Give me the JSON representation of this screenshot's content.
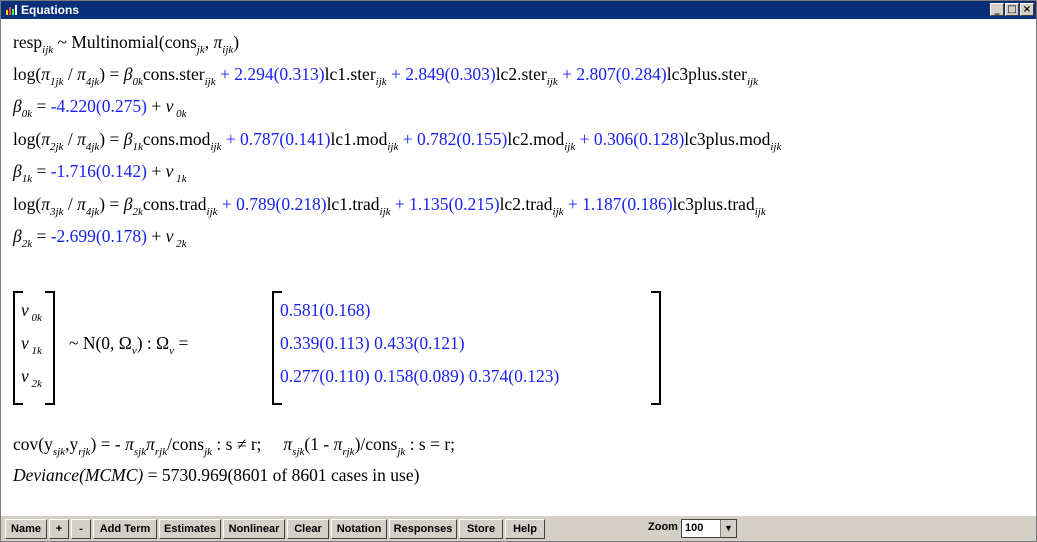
{
  "window": {
    "title": "Equations",
    "buttons": [
      "_",
      "□",
      "×"
    ]
  },
  "eq1": {
    "a": "resp",
    "a_sub": "ijk",
    "b": " ~ Multinomial(cons",
    "b_sub": "jk",
    "c": ", ",
    "d": "π",
    "d_sub": "ijk",
    "e": ")"
  },
  "eq2": {
    "l1": "log(",
    "pi1": "π",
    "pi1_sub": "1jk",
    "l2": " / ",
    "pi2": "π",
    "pi2_sub": "4jk",
    "l3": ") = ",
    "beta": "β",
    "beta_sub": "0k",
    "t0": "cons.ster",
    "t0_sub": "ijk",
    "c1": " + 2.294(0.313)",
    "t1": "lc1.ster",
    "t1_sub": "ijk",
    "c2": " + 2.849(0.303)",
    "t2": "lc2.ster",
    "t2_sub": "ijk",
    "c3": " + 2.807(0.284)",
    "t3": "lc3plus.ster",
    "t3_sub": "ijk"
  },
  "eq3": {
    "beta": "β",
    "beta_sub": "0k",
    "eqs": " = ",
    "val": "-4.220(0.275)",
    "plus": " + ",
    "v": "v",
    "v_sub": " 0k"
  },
  "eq4": {
    "l1": "log(",
    "pi1": "π",
    "pi1_sub": "2jk",
    "l2": " / ",
    "pi2": "π",
    "pi2_sub": "4jk",
    "l3": ") = ",
    "beta": "β",
    "beta_sub": "1k",
    "t0": "cons.mod",
    "t0_sub": "ijk",
    "c1": " + 0.787(0.141)",
    "t1": "lc1.mod",
    "t1_sub": "ijk",
    "c2": " + 0.782(0.155)",
    "t2": "lc2.mod",
    "t2_sub": "ijk",
    "c3": " + 0.306(0.128)",
    "t3": "lc3plus.mod",
    "t3_sub": "ijk"
  },
  "eq5": {
    "beta": "β",
    "beta_sub": "1k",
    "eqs": " = ",
    "val": "-1.716(0.142)",
    "plus": " + ",
    "v": "v",
    "v_sub": " 1k"
  },
  "eq6": {
    "l1": "log(",
    "pi1": "π",
    "pi1_sub": "3jk",
    "l2": " / ",
    "pi2": "π",
    "pi2_sub": "4jk",
    "l3": ") = ",
    "beta": "β",
    "beta_sub": "2k",
    "t0": "cons.trad",
    "t0_sub": "ijk",
    "c1": " + 0.789(0.218)",
    "t1": "lc1.trad",
    "t1_sub": "ijk",
    "c2": " + 1.135(0.215)",
    "t2": "lc2.trad",
    "t2_sub": "ijk",
    "c3": " + 1.187(0.186)",
    "t3": "lc3plus.trad",
    "t3_sub": "ijk"
  },
  "eq7": {
    "beta": "β",
    "beta_sub": "2k",
    "eqs": " = ",
    "val": "-2.699(0.178)",
    "plus": " + ",
    "v": "v",
    "v_sub": " 2k"
  },
  "cov_block": {
    "vector": [
      {
        "v": "v",
        "sub": " 0k"
      },
      {
        "v": "v",
        "sub": " 1k"
      },
      {
        "v": "v",
        "sub": " 2k"
      }
    ],
    "dist": "~ N(0,  Ω",
    "dist_sub": "v",
    "dist_end": ")  :  Ω",
    "omega_sub": "v",
    "eqs": " =",
    "matrix": [
      [
        "0.581(0.168)"
      ],
      [
        "0.339(0.113)",
        "0.433(0.121)"
      ],
      [
        "0.277(0.110)",
        "0.158(0.089)",
        "0.374(0.123)"
      ]
    ]
  },
  "cov_line": {
    "a": "cov(y",
    "a_sub": "sjk",
    "b": ",y",
    "b_sub": "rjk",
    "c": ") = - ",
    "pi1": "π",
    "pi1_sub": "sjk",
    "pi2": "π",
    "pi2_sub": "rjk",
    "d": "/cons",
    "d_sub": "jk",
    "e": " : s ≠ r;     ",
    "pi3": "π",
    "pi3_sub": "sjk",
    "f": "(1 - ",
    "pi4": "π",
    "pi4_sub": "rjk",
    "g": ")/cons",
    "g_sub": "jk",
    "h": " : s = r;"
  },
  "deviance": {
    "label": "Deviance(MCMC)",
    "value": " = 5730.969(8601 of 8601 cases in use)"
  },
  "toolbar": {
    "buttons": [
      "Name",
      "+",
      "-",
      "Add Term",
      "Estimates",
      "Nonlinear",
      "Clear",
      "Notation",
      "Responses",
      "Store",
      "Help"
    ],
    "zoom_label": "Zoom",
    "zoom_value": "100"
  },
  "colors": {
    "accent": "#1a22f0",
    "titlebar": "#0a2f7a",
    "toolbar": "#d4d0c8"
  }
}
